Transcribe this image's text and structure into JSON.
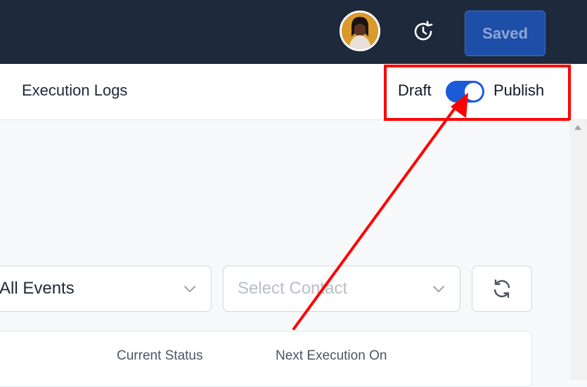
{
  "header": {
    "avatar_icon": "user-avatar",
    "history_icon": "history-icon",
    "saved_label": "Saved"
  },
  "subheader": {
    "tab_label": "Execution Logs",
    "draft_label": "Draft",
    "publish_label": "Publish",
    "toggle_state": "on"
  },
  "filters": {
    "events_value": "All Events",
    "contact_placeholder": "Select Contact",
    "refresh_icon": "refresh-icon"
  },
  "table": {
    "columns": [
      "Current Status",
      "Next Execution On"
    ]
  },
  "annotation": {
    "highlight_color": "#ff0000"
  }
}
